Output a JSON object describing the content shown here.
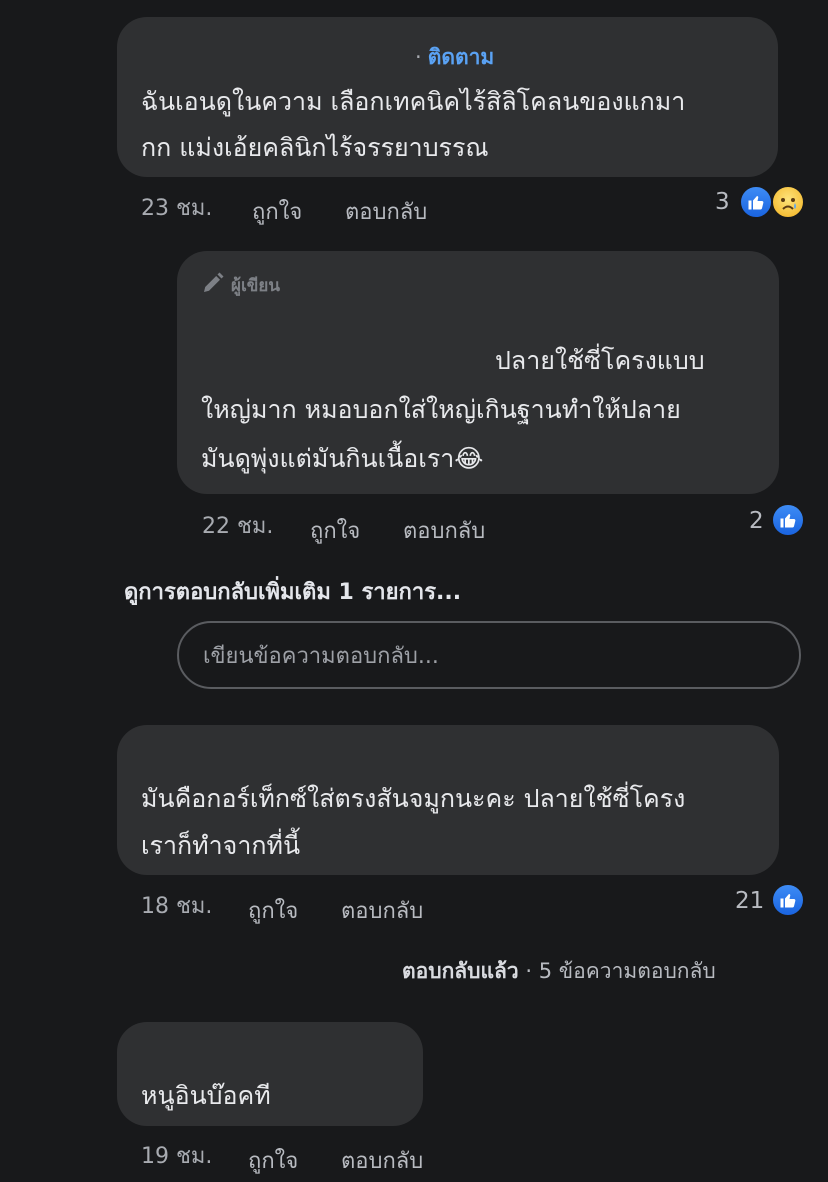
{
  "comments": [
    {
      "follow_label": "ติดตาม",
      "lines": [
        "ฉันเอนดูในความ เลือกเทคนิคไร้สิลิโคลนของแกมา",
        "กก แม่งเอ้ยคลินิกไร้จรรยาบรรณ"
      ],
      "time": "23 ชม.",
      "like_label": "ถูกใจ",
      "reply_label": "ตอบกลับ",
      "reaction_count": "3",
      "reactions": [
        "like-icon",
        "sad-icon"
      ]
    },
    {
      "author_badge": "ผู้เขียน",
      "lines": [
        "ปลายใช้ซี่โครงแบบ",
        "ใหญ่มาก หมอบอกใส่ใหญ่เกินฐานทำให้ปลาย",
        "มันดูพุ่งแต่มันกินเนื้อเรา😂"
      ],
      "time": "22 ชม.",
      "like_label": "ถูกใจ",
      "reply_label": "ตอบกลับ",
      "reaction_count": "2",
      "reactions": [
        "like-icon"
      ]
    },
    {
      "lines": [
        "มันคือกอร์เท็กซ์ใส่ตรงสันจมูกนะคะ ปลายใช้ซี่โครง",
        "เราก็ทำจากที่นี้"
      ],
      "time": "18 ชม.",
      "like_label": "ถูกใจ",
      "reply_label": "ตอบกลับ",
      "reaction_count": "21",
      "reactions": [
        "like-icon"
      ]
    },
    {
      "lines": [
        "หนูอินบ๊อคที"
      ],
      "time": "19 ชม.",
      "like_label": "ถูกใจ",
      "reply_label": "ตอบกลับ"
    }
  ],
  "more_replies": "ดูการตอบกลับเพิ่มเติม 1 รายการ...",
  "reply_input": {
    "placeholder": "เขียนข้อความตอบกลับ..."
  },
  "replied_summary": {
    "replied_label": "ตอบกลับแล้ว",
    "count_label": "5 ข้อความตอบกลับ"
  },
  "colors": {
    "background": "#18191b",
    "bubble": "#2f3032",
    "accent": "#5aa2f4",
    "like": "#1a64e0"
  }
}
